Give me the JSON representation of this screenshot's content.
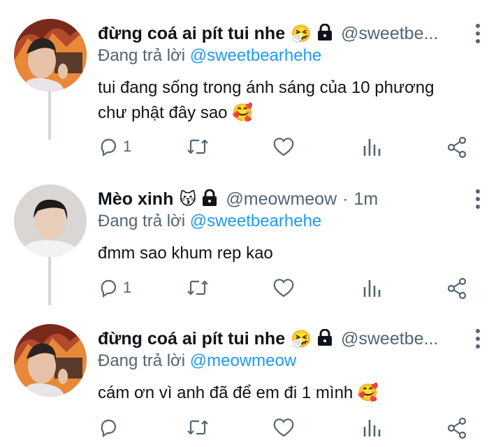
{
  "tweets": [
    {
      "name": "đừng coá ai pít tui nhe",
      "emoji": "🤧",
      "handle": "@sweetbe...",
      "separator": "",
      "time": "",
      "reply_prefix": "Đang trả lời",
      "reply_to": "@sweetbearhehe",
      "text": "tui đang sống trong ánh sáng của 10 phương chư phật đây sao 🥰",
      "reply_count": "1"
    },
    {
      "name": "Mèo xinh",
      "emoji": "😽",
      "handle": "@meowmeow",
      "separator": "·",
      "time": "1m",
      "reply_prefix": "Đang trả lời",
      "reply_to": "@sweetbearhehe",
      "text": "đmm sao khum rep kao",
      "reply_count": "1"
    },
    {
      "name": "đừng coá ai pít tui nhe",
      "emoji": "🤧",
      "handle": "@sweetbe...",
      "separator": "",
      "time": "",
      "reply_prefix": "Đang trả lời",
      "reply_to": "@meowmeow",
      "text": "cám ơn vì anh đã để em đi 1 mình 🥰",
      "reply_count": ""
    }
  ],
  "icons": [
    "reply-icon",
    "retweet-icon",
    "like-icon",
    "views-icon",
    "share-icon",
    "lock-icon",
    "more-icon"
  ],
  "colors": {
    "mention": "#1d9bf0",
    "muted": "#536471",
    "text": "#0f1419",
    "thread_line": "#cfd9de"
  }
}
